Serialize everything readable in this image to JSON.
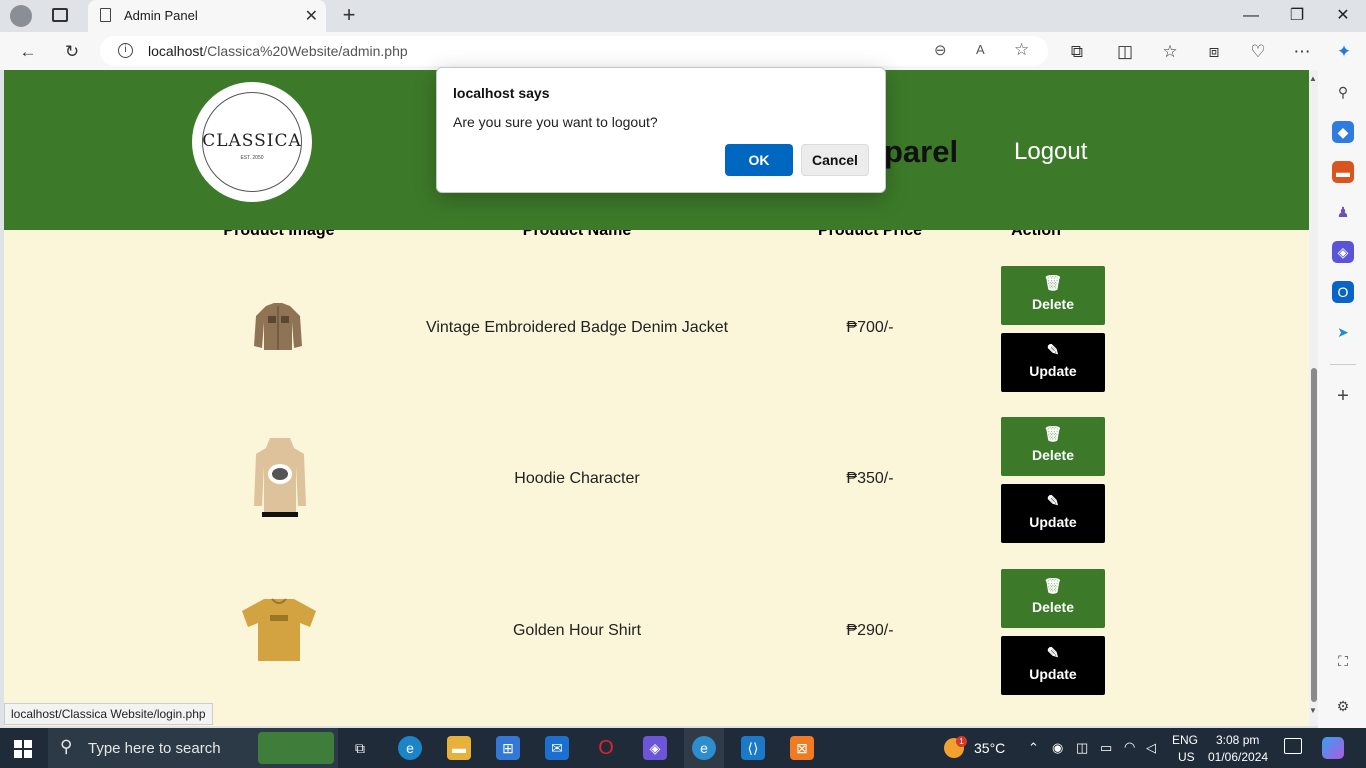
{
  "browser": {
    "tab_title": "Admin Panel",
    "url_host": "localhost",
    "url_path": "/Classica%20Website/admin.php"
  },
  "site": {
    "logo_text": "CLASSICA",
    "logo_est": "EST. 2050",
    "page_title": "parel",
    "logout_label": "Logout"
  },
  "table": {
    "headers": [
      "Product Image",
      "Product Name",
      "Product Price",
      "Action"
    ],
    "rows": [
      {
        "name": "Vintage Embroidered Badge Denim Jacket",
        "price": "₱700/-"
      },
      {
        "name": "Hoodie Character",
        "price": "₱350/-"
      },
      {
        "name": "Golden Hour Shirt",
        "price": "₱290/-"
      }
    ],
    "delete_label": "Delete",
    "update_label": "Update"
  },
  "dialog": {
    "title": "localhost says",
    "message": "Are you sure you want to logout?",
    "ok_label": "OK",
    "cancel_label": "Cancel"
  },
  "status_url": "localhost/Classica Website/login.php",
  "taskbar": {
    "search_placeholder": "Type here to search",
    "temperature": "35°C",
    "language": "ENG",
    "region": "US",
    "time": "3:08 pm",
    "date": "01/06/2024",
    "weather_badge": "1"
  },
  "colors": {
    "header_green": "#3c7a29",
    "page_bg": "#fbf6d9",
    "ok_blue": "#0067c0"
  }
}
